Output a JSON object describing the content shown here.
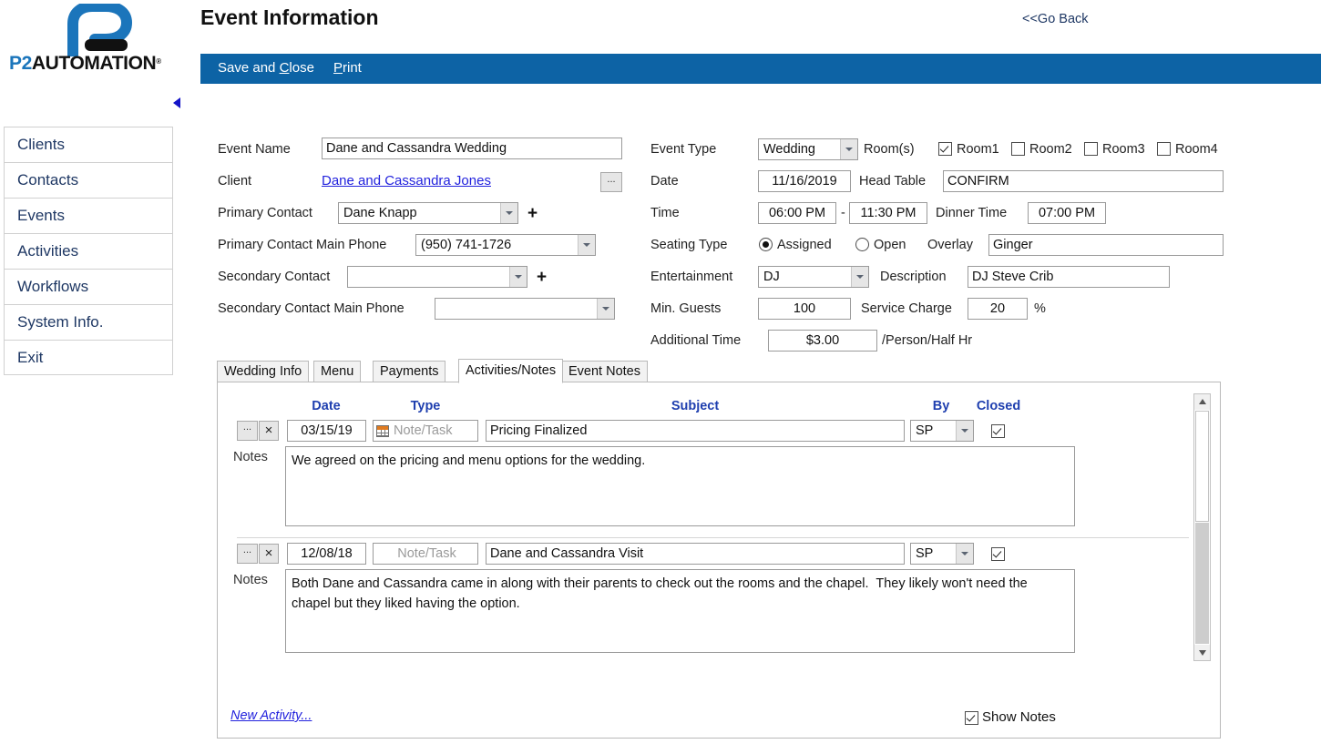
{
  "brand": {
    "logo_text_p2": "P2",
    "logo_text_rest": "AUTOMATION",
    "logo_tm": "®",
    "logo_mark_name": "p2-logo-mark",
    "accent_blue": "#1b75bb",
    "bar_blue": "#0d63a5",
    "link_blue": "#2222dd",
    "header_blue": "#1f3faf"
  },
  "header": {
    "title": "Event Information",
    "go_back": "<<Go Back"
  },
  "action_bar": {
    "save_prefix": "Save and ",
    "save_accel": "C",
    "save_suffix": "lose",
    "print_accel": "P",
    "print_suffix": "rint"
  },
  "sidebar": {
    "collapse_icon": "caret-left-icon",
    "items": [
      {
        "label": "Clients"
      },
      {
        "label": "Contacts"
      },
      {
        "label": "Events"
      },
      {
        "label": "Activities"
      },
      {
        "label": "Workflows"
      },
      {
        "label": "System Info."
      },
      {
        "label": "Exit"
      }
    ]
  },
  "form": {
    "left": {
      "event_name_label": "Event Name",
      "event_name_value": "Dane and Cassandra Wedding",
      "client_label": "Client",
      "client_value": "Dane and Cassandra Jones",
      "client_browse": "...",
      "primary_contact_label": "Primary Contact",
      "primary_contact_value": "Dane Knapp",
      "primary_contact_add": "+",
      "primary_phone_label": "Primary Contact Main Phone",
      "primary_phone_value": "(950) 741-1726",
      "secondary_contact_label": "Secondary Contact",
      "secondary_contact_value": "",
      "secondary_contact_add": "+",
      "secondary_phone_label": "Secondary Contact Main Phone",
      "secondary_phone_value": ""
    },
    "right": {
      "event_type_label": "Event Type",
      "event_type_value": "Wedding",
      "rooms_label": "Room(s)",
      "rooms": [
        {
          "label": "Room1",
          "checked": true
        },
        {
          "label": "Room2",
          "checked": false
        },
        {
          "label": "Room3",
          "checked": false
        },
        {
          "label": "Room4",
          "checked": false
        }
      ],
      "date_label": "Date",
      "date_value": "11/16/2019",
      "head_table_label": "Head Table",
      "head_table_value": "CONFIRM",
      "time_label": "Time",
      "time_start": "06:00 PM",
      "time_dash": "-",
      "time_end": "11:30 PM",
      "dinner_time_label": "Dinner Time",
      "dinner_time_value": "07:00 PM",
      "seating_type_label": "Seating Type",
      "seating_assigned_label": "Assigned",
      "seating_open_label": "Open",
      "seating_selected": "Assigned",
      "overlay_label": "Overlay",
      "overlay_value": "Ginger",
      "entertainment_label": "Entertainment",
      "entertainment_value": "DJ",
      "description_label": "Description",
      "description_value": "DJ Steve Crib",
      "min_guests_label": "Min. Guests",
      "min_guests_value": "100",
      "service_charge_label": "Service Charge",
      "service_charge_value": "20",
      "service_charge_unit": "%",
      "additional_time_label": "Additional Time",
      "additional_time_value": "$3.00",
      "additional_time_unit": "/Person/Half Hr"
    }
  },
  "tabs": [
    {
      "label": "Wedding Info",
      "active": false
    },
    {
      "label": "Menu",
      "active": false
    },
    {
      "label": "Payments",
      "active": false
    },
    {
      "label": "Activities/Notes",
      "active": true
    },
    {
      "label": "Event Notes",
      "active": false
    }
  ],
  "grid": {
    "columns": [
      "Date",
      "Type",
      "Subject",
      "By",
      "Closed"
    ],
    "notes_label": "Notes",
    "type_placeholder": "Note/Task",
    "row_browse": "...",
    "row_delete": "×",
    "rows": [
      {
        "date": "03/15/19",
        "type": "",
        "has_type_icon": true,
        "subject": "Pricing Finalized",
        "by": "SP",
        "closed": true,
        "notes": "We agreed on the pricing and menu options for the wedding."
      },
      {
        "date": "12/08/18",
        "type": "",
        "has_type_icon": false,
        "subject": "Dane and Cassandra Visit",
        "by": "SP",
        "closed": true,
        "notes": "Both Dane and Cassandra came in along with their parents to check out the rooms and the chapel.  They likely won't need the chapel but they liked having the option."
      }
    ]
  },
  "footer": {
    "new_activity": "New Activity...",
    "show_notes_label": "Show Notes",
    "show_notes_checked": true
  },
  "scrollbar": {
    "up_icon": "caret-up-icon",
    "down_icon": "caret-down-icon"
  }
}
